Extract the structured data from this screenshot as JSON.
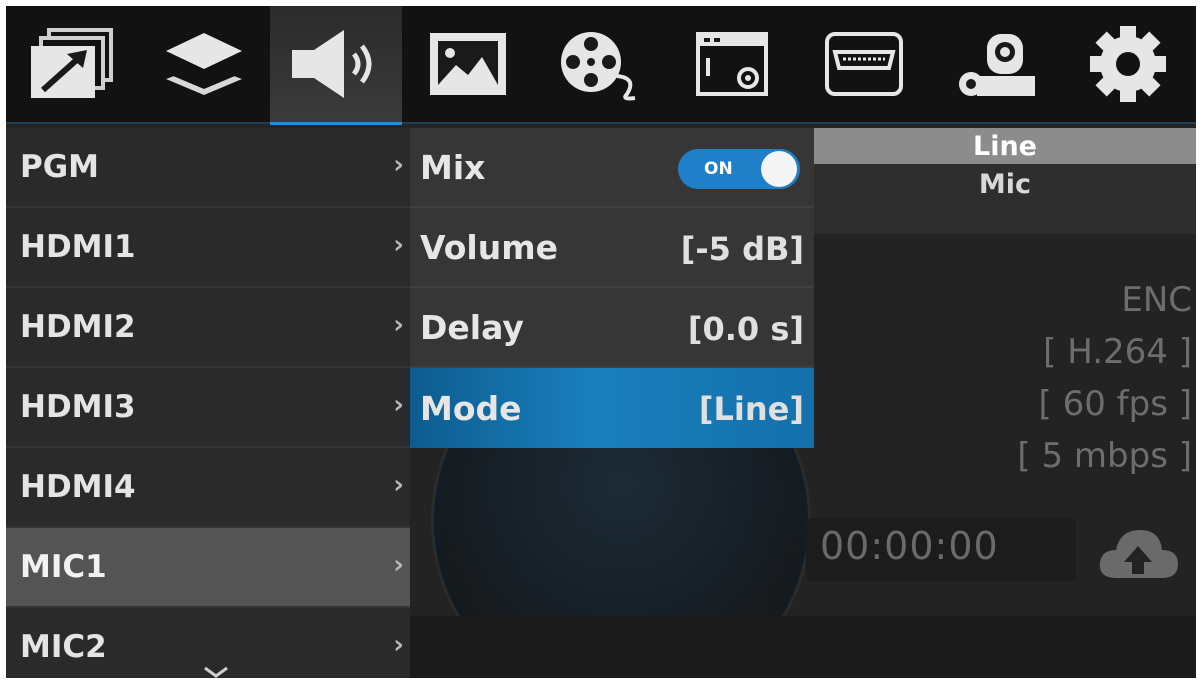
{
  "toolbar": {
    "buttons": [
      {
        "name": "output-icon",
        "active": false
      },
      {
        "name": "layers-icon",
        "active": false
      },
      {
        "name": "audio-icon",
        "active": true
      },
      {
        "name": "image-icon",
        "active": false
      },
      {
        "name": "film-reel-icon",
        "active": false
      },
      {
        "name": "window-settings-icon",
        "active": false
      },
      {
        "name": "hdmi-icon",
        "active": false
      },
      {
        "name": "camera-settings-icon",
        "active": false
      },
      {
        "name": "gear-icon",
        "active": false
      }
    ]
  },
  "source_menu": {
    "items": [
      {
        "label": "PGM",
        "selected": false
      },
      {
        "label": "HDMI1",
        "selected": false
      },
      {
        "label": "HDMI2",
        "selected": false
      },
      {
        "label": "HDMI3",
        "selected": false
      },
      {
        "label": "HDMI4",
        "selected": false
      },
      {
        "label": "MIC1",
        "selected": true
      },
      {
        "label": "MIC2",
        "selected": false
      }
    ],
    "chevron": "›"
  },
  "settings_menu": {
    "mix": {
      "label": "Mix",
      "toggle": "ON"
    },
    "volume": {
      "label": "Volume",
      "value": "[-5 dB]"
    },
    "delay": {
      "label": "Delay",
      "value": "[0.0 s]"
    },
    "mode": {
      "label": "Mode",
      "value": "[Line]"
    }
  },
  "mode_options": {
    "options": [
      "Line",
      "Mic"
    ],
    "selected": "Line"
  },
  "encoder": {
    "title": "ENC",
    "codec": "[ H.264 ]",
    "fps": "[ 60 fps ]",
    "bitrate": "[ 5 mbps ]"
  },
  "status": {
    "timer": "00:00:00",
    "cloud_icon": "cloud-upload-icon"
  },
  "colors": {
    "accent": "#1a7fbd",
    "toggle_on": "#1f7fc8"
  }
}
